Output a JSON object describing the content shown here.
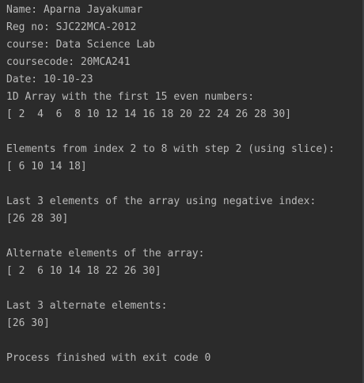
{
  "colors": {
    "background": "#2b2b2b",
    "text": "#bbbbbb"
  },
  "output": {
    "name": "Name: Aparna Jayakumar",
    "reg": "Reg no: SJC22MCA-2012",
    "course": "course: Data Science Lab",
    "coursecode": "coursecode: 20MCA241",
    "date": "Date: 10-10-23",
    "array_heading": "1D Array with the first 15 even numbers:",
    "array_value": "[ 2  4  6  8 10 12 14 16 18 20 22 24 26 28 30]",
    "slice_heading": "Elements from index 2 to 8 with step 2 (using slice):",
    "slice_value": "[ 6 10 14 18]",
    "last3_heading": "Last 3 elements of the array using negative index:",
    "last3_value": "[26 28 30]",
    "alternate_heading": "Alternate elements of the array:",
    "alternate_value": "[ 2  6 10 14 18 22 26 30]",
    "last3_alt_heading": "Last 3 alternate elements:",
    "last3_alt_value": "[26 30]",
    "exit_message": "Process finished with exit code 0"
  }
}
